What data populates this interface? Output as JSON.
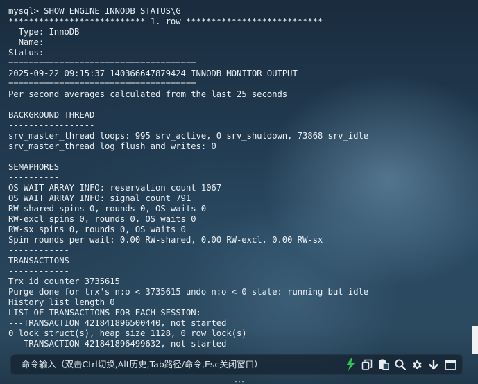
{
  "terminal": {
    "lines": [
      "mysql> SHOW ENGINE INNODB STATUS\\G",
      "*************************** 1. row ***************************",
      "  Type: InnoDB",
      "  Name: ",
      "Status: ",
      "=====================================",
      "2025-09-22 09:15:37 140366647879424 INNODB MONITOR OUTPUT",
      "=====================================",
      "Per second averages calculated from the last 25 seconds",
      "-----------------",
      "BACKGROUND THREAD",
      "-----------------",
      "srv_master_thread loops: 995 srv_active, 0 srv_shutdown, 73868 srv_idle",
      "srv_master_thread log flush and writes: 0",
      "----------",
      "SEMAPHORES",
      "----------",
      "OS WAIT ARRAY INFO: reservation count 1067",
      "OS WAIT ARRAY INFO: signal count 791",
      "RW-shared spins 0, rounds 0, OS waits 0",
      "RW-excl spins 0, rounds 0, OS waits 0",
      "RW-sx spins 0, rounds 0, OS waits 0",
      "Spin rounds per wait: 0.00 RW-shared, 0.00 RW-excl, 0.00 RW-sx",
      "------------",
      "TRANSACTIONS",
      "------------",
      "Trx id counter 3735615",
      "Purge done for trx's n:o < 3735615 undo n:o < 0 state: running but idle",
      "History list length 0",
      "LIST OF TRANSACTIONS FOR EACH SESSION:",
      "---TRANSACTION 421841896500440, not started",
      "0 lock struct(s), heap size 1128, 0 row lock(s)",
      "---TRANSACTION 421841896499632, not started"
    ]
  },
  "command_bar": {
    "placeholder": "命令输入（双击Ctrl切换,Alt历史,Tab路径/命令,Esc关闭窗口）"
  },
  "toolbar": {
    "icons": [
      "lightning-icon",
      "copy-icon",
      "paste-icon",
      "search-icon",
      "gear-icon",
      "download-icon",
      "window-icon"
    ],
    "accent_color": "#33c24d"
  }
}
